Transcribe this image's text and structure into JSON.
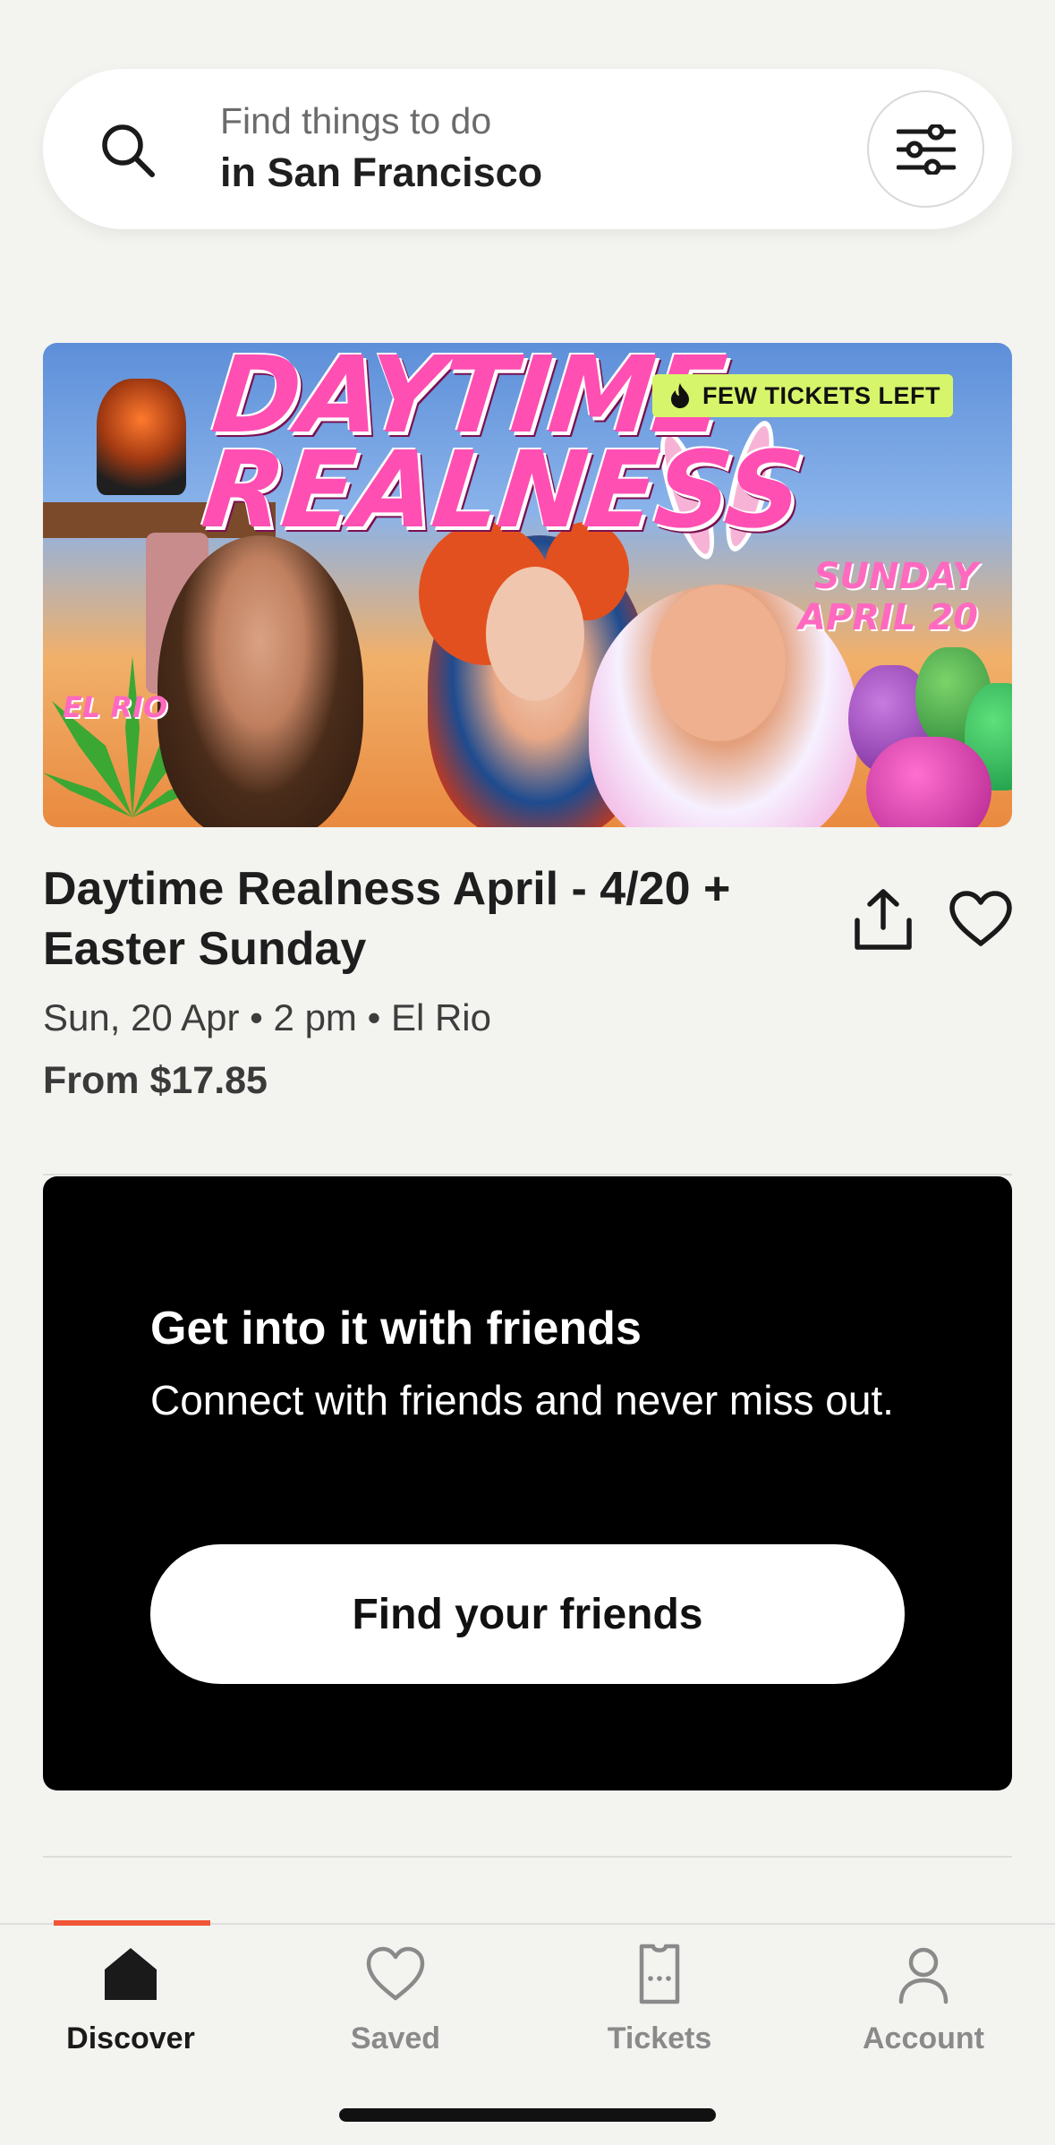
{
  "search": {
    "line1": "Find things to do",
    "line2": "in San Francisco",
    "icon": "search-icon",
    "filter_icon": "filter-sliders-icon"
  },
  "event": {
    "image": {
      "title_line1": "DAYTIME",
      "title_line2": "REALNESS",
      "badge": "FEW TICKETS LEFT",
      "badge_icon": "flame-icon",
      "date_line1": "SUNDAY",
      "date_line2": "APRIL 20",
      "venue": "EL RIO",
      "badge_color": "#d7f56a",
      "title_color": "#ff4fb3"
    },
    "title": "Daytime Realness April - 4/20 + Easter Sunday",
    "meta": "Sun, 20 Apr • 2 pm • El Rio",
    "price": "From $17.85",
    "share_icon": "share-icon",
    "save_icon": "heart-icon"
  },
  "friends_card": {
    "heading": "Get into it with friends",
    "subtitle": "Connect with friends and never miss out.",
    "button": "Find your friends"
  },
  "tabs": [
    {
      "label": "Discover",
      "icon": "home-icon",
      "active": true
    },
    {
      "label": "Saved",
      "icon": "heart-icon",
      "active": false
    },
    {
      "label": "Tickets",
      "icon": "ticket-icon",
      "active": false
    },
    {
      "label": "Account",
      "icon": "person-icon",
      "active": false
    }
  ],
  "colors": {
    "accent": "#f05537",
    "background": "#f3f3f0",
    "card": "#000000"
  }
}
